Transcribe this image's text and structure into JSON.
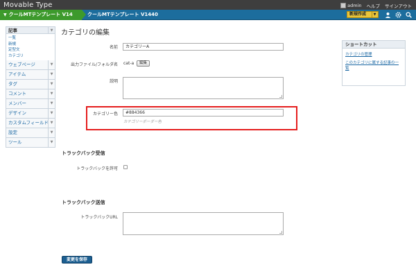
{
  "app": {
    "logo": "Movable Type"
  },
  "top_links": {
    "user": "admin",
    "help": "ヘルプ",
    "signout": "サインアウト"
  },
  "navbar": {
    "site": "クールMTテンプレート V14",
    "blog": "クールMTテンプレート V1440",
    "new_label": "新規作成"
  },
  "sidebar": {
    "entry_group": "記事",
    "entry_sub": [
      "一覧",
      "新規",
      "定型文",
      "カテゴリ"
    ],
    "items": [
      "ウェブページ",
      "アイテム",
      "タグ",
      "コメント",
      "メンバー",
      "デザイン",
      "カスタムフィールド",
      "設定",
      "ツール"
    ]
  },
  "page": {
    "title": "カテゴリの編集"
  },
  "form": {
    "name_label": "名前",
    "name_value": "カテゴリーA",
    "folder_label": "出力ファイル/フォルダ名",
    "folder_value": "cat-a",
    "edit_button": "編集",
    "desc_label": "説明",
    "color_label": "カテゴリー色",
    "color_value": "#884366",
    "color_hint": "カテゴリーボーダー色"
  },
  "trackback_receive": {
    "title": "トラックバック受信",
    "allow_label": "トラックバックを許可"
  },
  "trackback_send": {
    "title": "トラックバック送信",
    "url_label": "トラックバックURL"
  },
  "actions": {
    "save": "変更を保存"
  },
  "shortcut": {
    "title": "ショートカット",
    "links": [
      "カテゴリの管理",
      "このカテゴリに属する記事の一覧"
    ]
  },
  "colors": {
    "accent_green": "#3d9a2c",
    "nav_blue": "#1c6d9d",
    "highlight_red": "#e51c1c"
  }
}
